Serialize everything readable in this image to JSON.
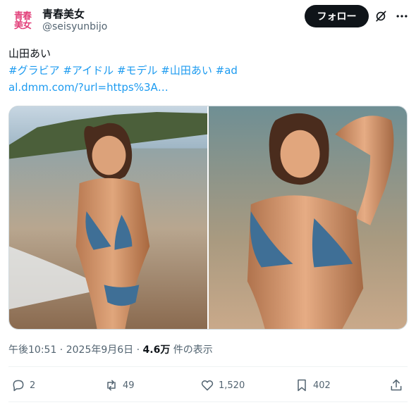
{
  "account": {
    "avatar_line1": "青春",
    "avatar_line2": "美女",
    "display_name": "青春美女",
    "handle": "@seisyunbijo"
  },
  "header": {
    "follow_label": "フォロー",
    "grok_icon": "grok-icon",
    "more_icon": "more-icon"
  },
  "tweet": {
    "text_line1": "山田あい",
    "hashtags": [
      "#グラビア",
      "#アイドル",
      "#モデル",
      "#山田あい",
      "#ad"
    ],
    "link": "al.dmm.com/?url=https%3A…"
  },
  "media": {
    "photos": [
      "photo-1",
      "photo-2"
    ]
  },
  "meta": {
    "time": "午後10:51",
    "separator": " · ",
    "date": "2025年9月6日",
    "views_count": "4.6万",
    "views_label": " 件の表示"
  },
  "actions": {
    "reply_count": "2",
    "repost_count": "49",
    "like_count": "1,520",
    "bookmark_count": "402"
  },
  "colors": {
    "accent": "#1d9bf0",
    "text": "#0f1419",
    "secondary": "#536471",
    "avatar_pink": "#e2407a"
  }
}
